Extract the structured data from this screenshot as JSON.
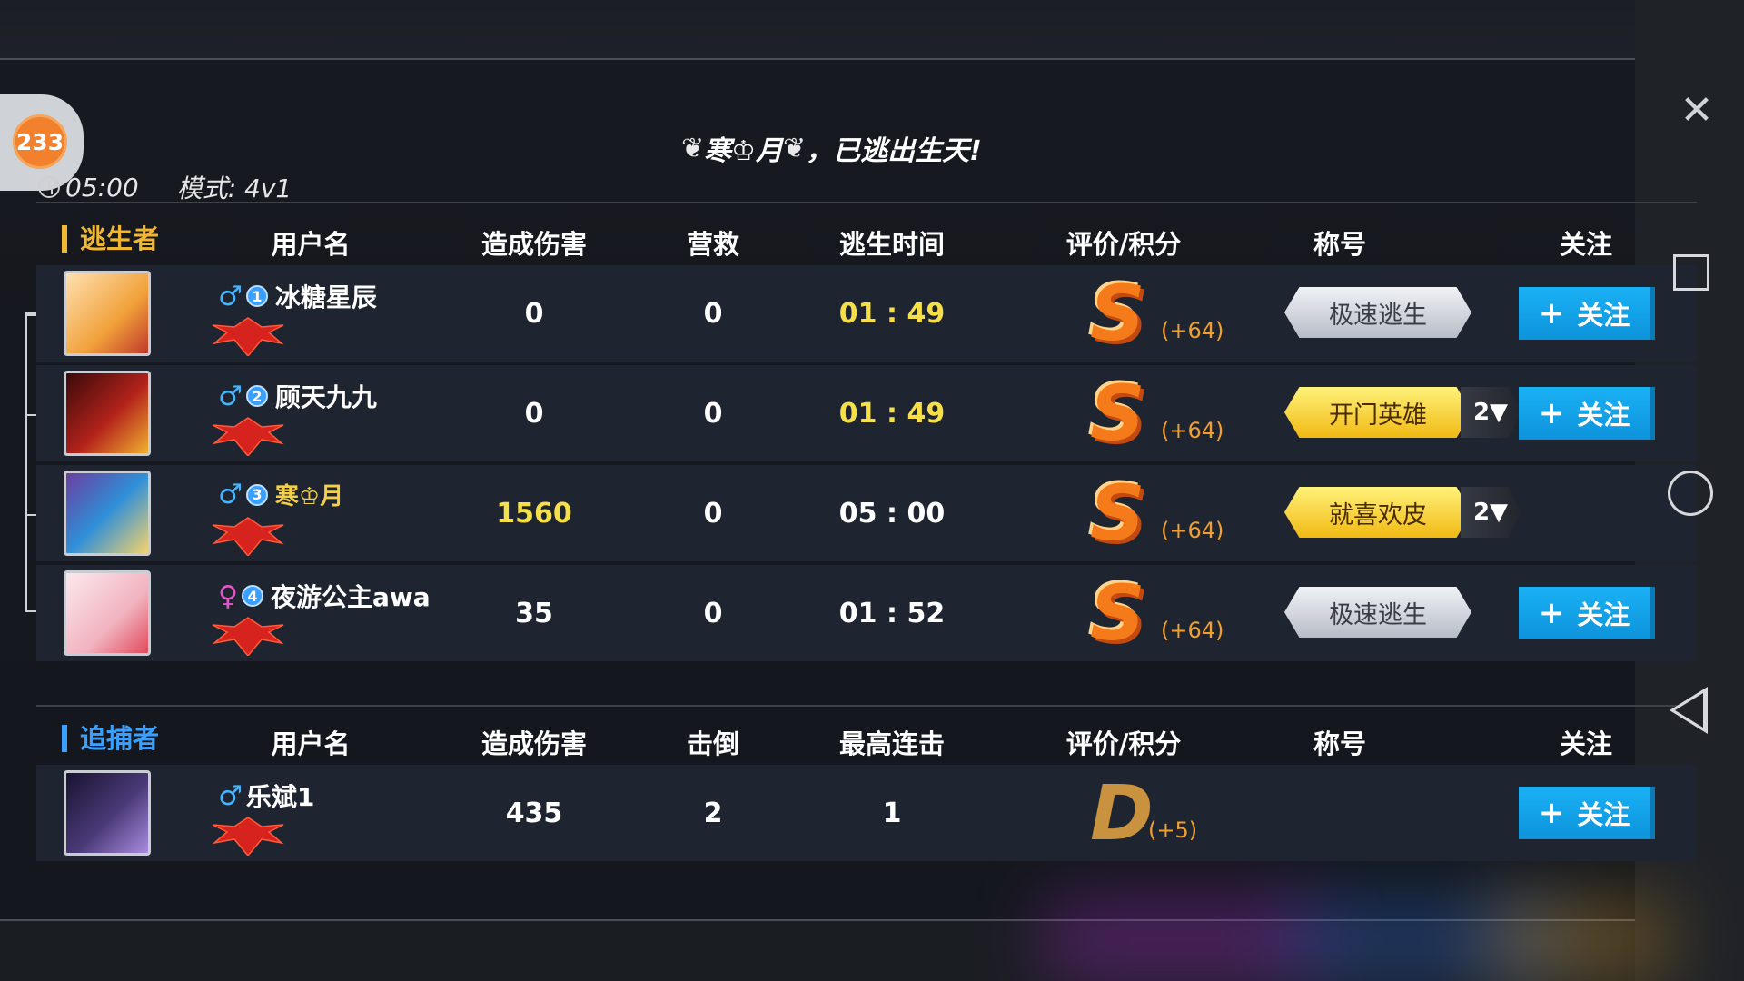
{
  "badge": {
    "count": "233"
  },
  "header": {
    "player_name": "寒♔月",
    "escaped_text": "，已逃出生天!"
  },
  "meta": {
    "time": "05:00",
    "mode": "模式: 4v1"
  },
  "survivors": {
    "role_label": "逃生者",
    "role_color": "#f0b733",
    "columns": [
      "用户名",
      "造成伤害",
      "营救",
      "逃生时间",
      "评价/积分",
      "称号",
      "关注"
    ],
    "rows": [
      {
        "gender": "♂",
        "gender_color": "#44b5ff",
        "num": "1",
        "name": "冰糖星辰",
        "damage": "0",
        "rescue": "0",
        "escape_time": "01 : 49",
        "time_color": "#f6e04a",
        "grade": "S",
        "points": "(+64)",
        "title": "极速逃生",
        "title_style": "silver",
        "title_count": "",
        "follow": "关注",
        "avatar": "cartoon-avatar"
      },
      {
        "gender": "♂",
        "gender_color": "#44b5ff",
        "num": "2",
        "name": "顾天九九",
        "damage": "0",
        "rescue": "0",
        "escape_time": "01 : 49",
        "time_color": "#f6e04a",
        "grade": "S",
        "points": "(+64)",
        "title": "开门英雄",
        "title_style": "gold",
        "title_count": "2▼",
        "follow": "关注",
        "avatar": "red-hair-avatar"
      },
      {
        "gender": "♂",
        "gender_color": "#44b5ff",
        "num": "3",
        "name": "寒♔月",
        "damage": "1560",
        "rescue": "0",
        "escape_time": "05 : 00",
        "time_color": "#ffffff",
        "grade": "S",
        "points": "(+64)",
        "title": "就喜欢皮",
        "title_style": "gold",
        "title_count": "2▼",
        "follow": "",
        "avatar": "masked-avatar"
      },
      {
        "gender": "♀",
        "gender_color": "#e655c8",
        "num": "4",
        "name": "夜游公主awa",
        "damage": "35",
        "rescue": "0",
        "escape_time": "01 : 52",
        "time_color": "#ffffff",
        "grade": "S",
        "points": "(+64)",
        "title": "极速逃生",
        "title_style": "silver",
        "title_count": "",
        "follow": "关注",
        "avatar": "pink-hair-avatar"
      }
    ]
  },
  "hunters": {
    "role_label": "追捕者",
    "role_color": "#3aa0ff",
    "columns": [
      "用户名",
      "造成伤害",
      "击倒",
      "最高连击",
      "评价/积分",
      "称号",
      "关注"
    ],
    "rows": [
      {
        "gender": "♂",
        "gender_color": "#44b5ff",
        "name": "乐斌1",
        "damage": "435",
        "knockdowns": "2",
        "max_combo": "1",
        "grade": "D",
        "points": "(+5)",
        "follow": "关注",
        "avatar": "dark-avatar"
      }
    ]
  },
  "colors": {
    "s_grade": "#f57b1a",
    "d_grade": "#c8923e",
    "follow": "#14a3e8"
  }
}
